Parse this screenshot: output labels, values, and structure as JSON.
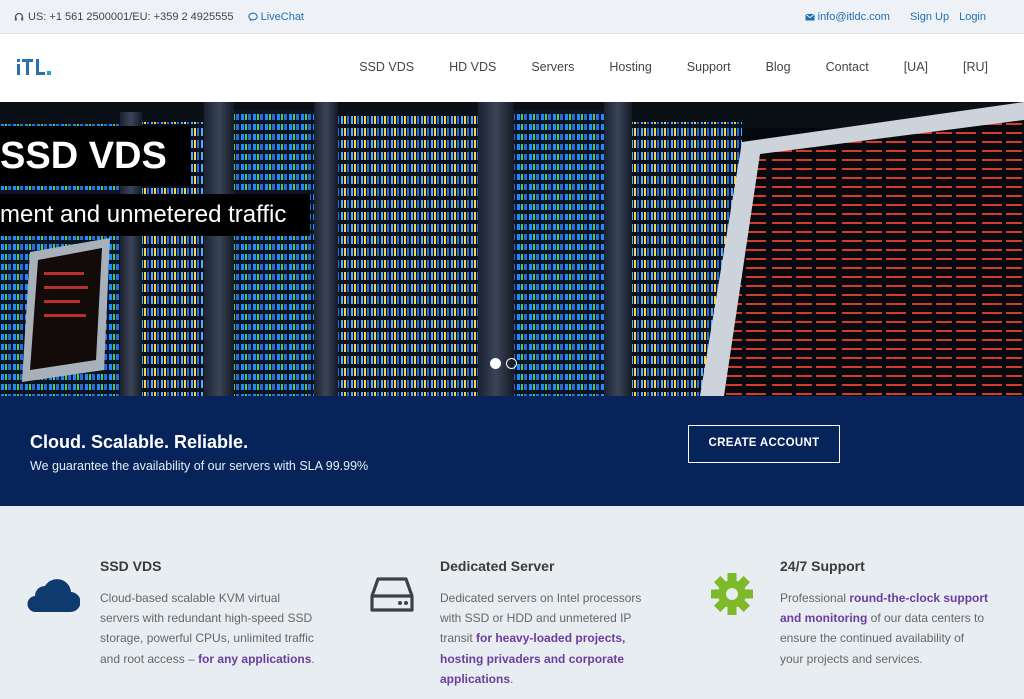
{
  "topbar": {
    "phone": "US: +1 561 2500001/EU: +359 2 4925555",
    "livechat": "LiveChat",
    "email": "info@itldc.com",
    "signup": "Sign Up",
    "login": "Login"
  },
  "header": {
    "logo_text": "iTL.",
    "nav": [
      "SSD VDS",
      "HD VDS",
      "Servers",
      "Hosting",
      "Support",
      "Blog",
      "Contact",
      "[UA]",
      "[RU]"
    ]
  },
  "hero": {
    "title": "SSD VDS",
    "subtitle": "ment and unmetered traffic",
    "slides_total": 2,
    "active_slide": 1
  },
  "banner": {
    "heading": "Cloud. Scalable. Reliable.",
    "text": "We guarantee the availability of our servers with SLA 99.99%",
    "button": "CREATE ACCOUNT"
  },
  "features": [
    {
      "icon": "cloud-icon",
      "title": "SSD VDS",
      "text": "Cloud-based scalable KVM virtual servers with redundant high-speed SSD storage, powerful CPUs, unlimited traffic and root access – ",
      "highlight": "for any applications",
      "tail": "."
    },
    {
      "icon": "hard-drive-icon",
      "title": "Dedicated Server",
      "text": "Dedicated servers on Intel processors with SSD or HDD and unmetered IP transit ",
      "highlight": "for heavy-loaded projects, hosting privaders and corporate applications",
      "tail": "."
    },
    {
      "icon": "gear-icon",
      "title": "24/7 Support",
      "text": "Professional ",
      "highlight": "round-the-clock support and monitoring",
      "tail": " of our data centers to ensure the continued availability of your projects and services."
    }
  ],
  "colors": {
    "banner_bg": "#062459",
    "link": "#1f6fb8",
    "highlight": "#6b3e9e",
    "cloud_icon": "#0f3a6e",
    "gear_icon": "#7db928"
  }
}
